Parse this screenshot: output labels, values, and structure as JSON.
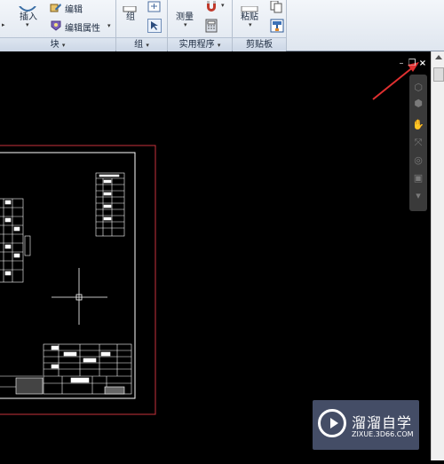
{
  "ribbon": {
    "block_panel": {
      "insert_label": "插入",
      "edit_label": "编辑",
      "edit_attributes_label": "编辑属性",
      "title": "块"
    },
    "group_panel": {
      "group_label": "组",
      "title": "组"
    },
    "utilities_panel": {
      "measure_label": "测量",
      "title": "实用程序"
    },
    "clipboard_panel": {
      "paste_label": "粘贴",
      "title": "剪贴板"
    }
  },
  "document_controls": {
    "minimize": "–",
    "restore": "❐",
    "close": "×"
  },
  "watermark": {
    "title": "溜溜自学",
    "url": "ZIXUE.3D66.COM"
  },
  "colors": {
    "canvas": "#000000",
    "border_red": "#c8323c",
    "frame_white": "#ffffff",
    "arrow_red": "#e03030",
    "crosshair": "#ffffff"
  }
}
